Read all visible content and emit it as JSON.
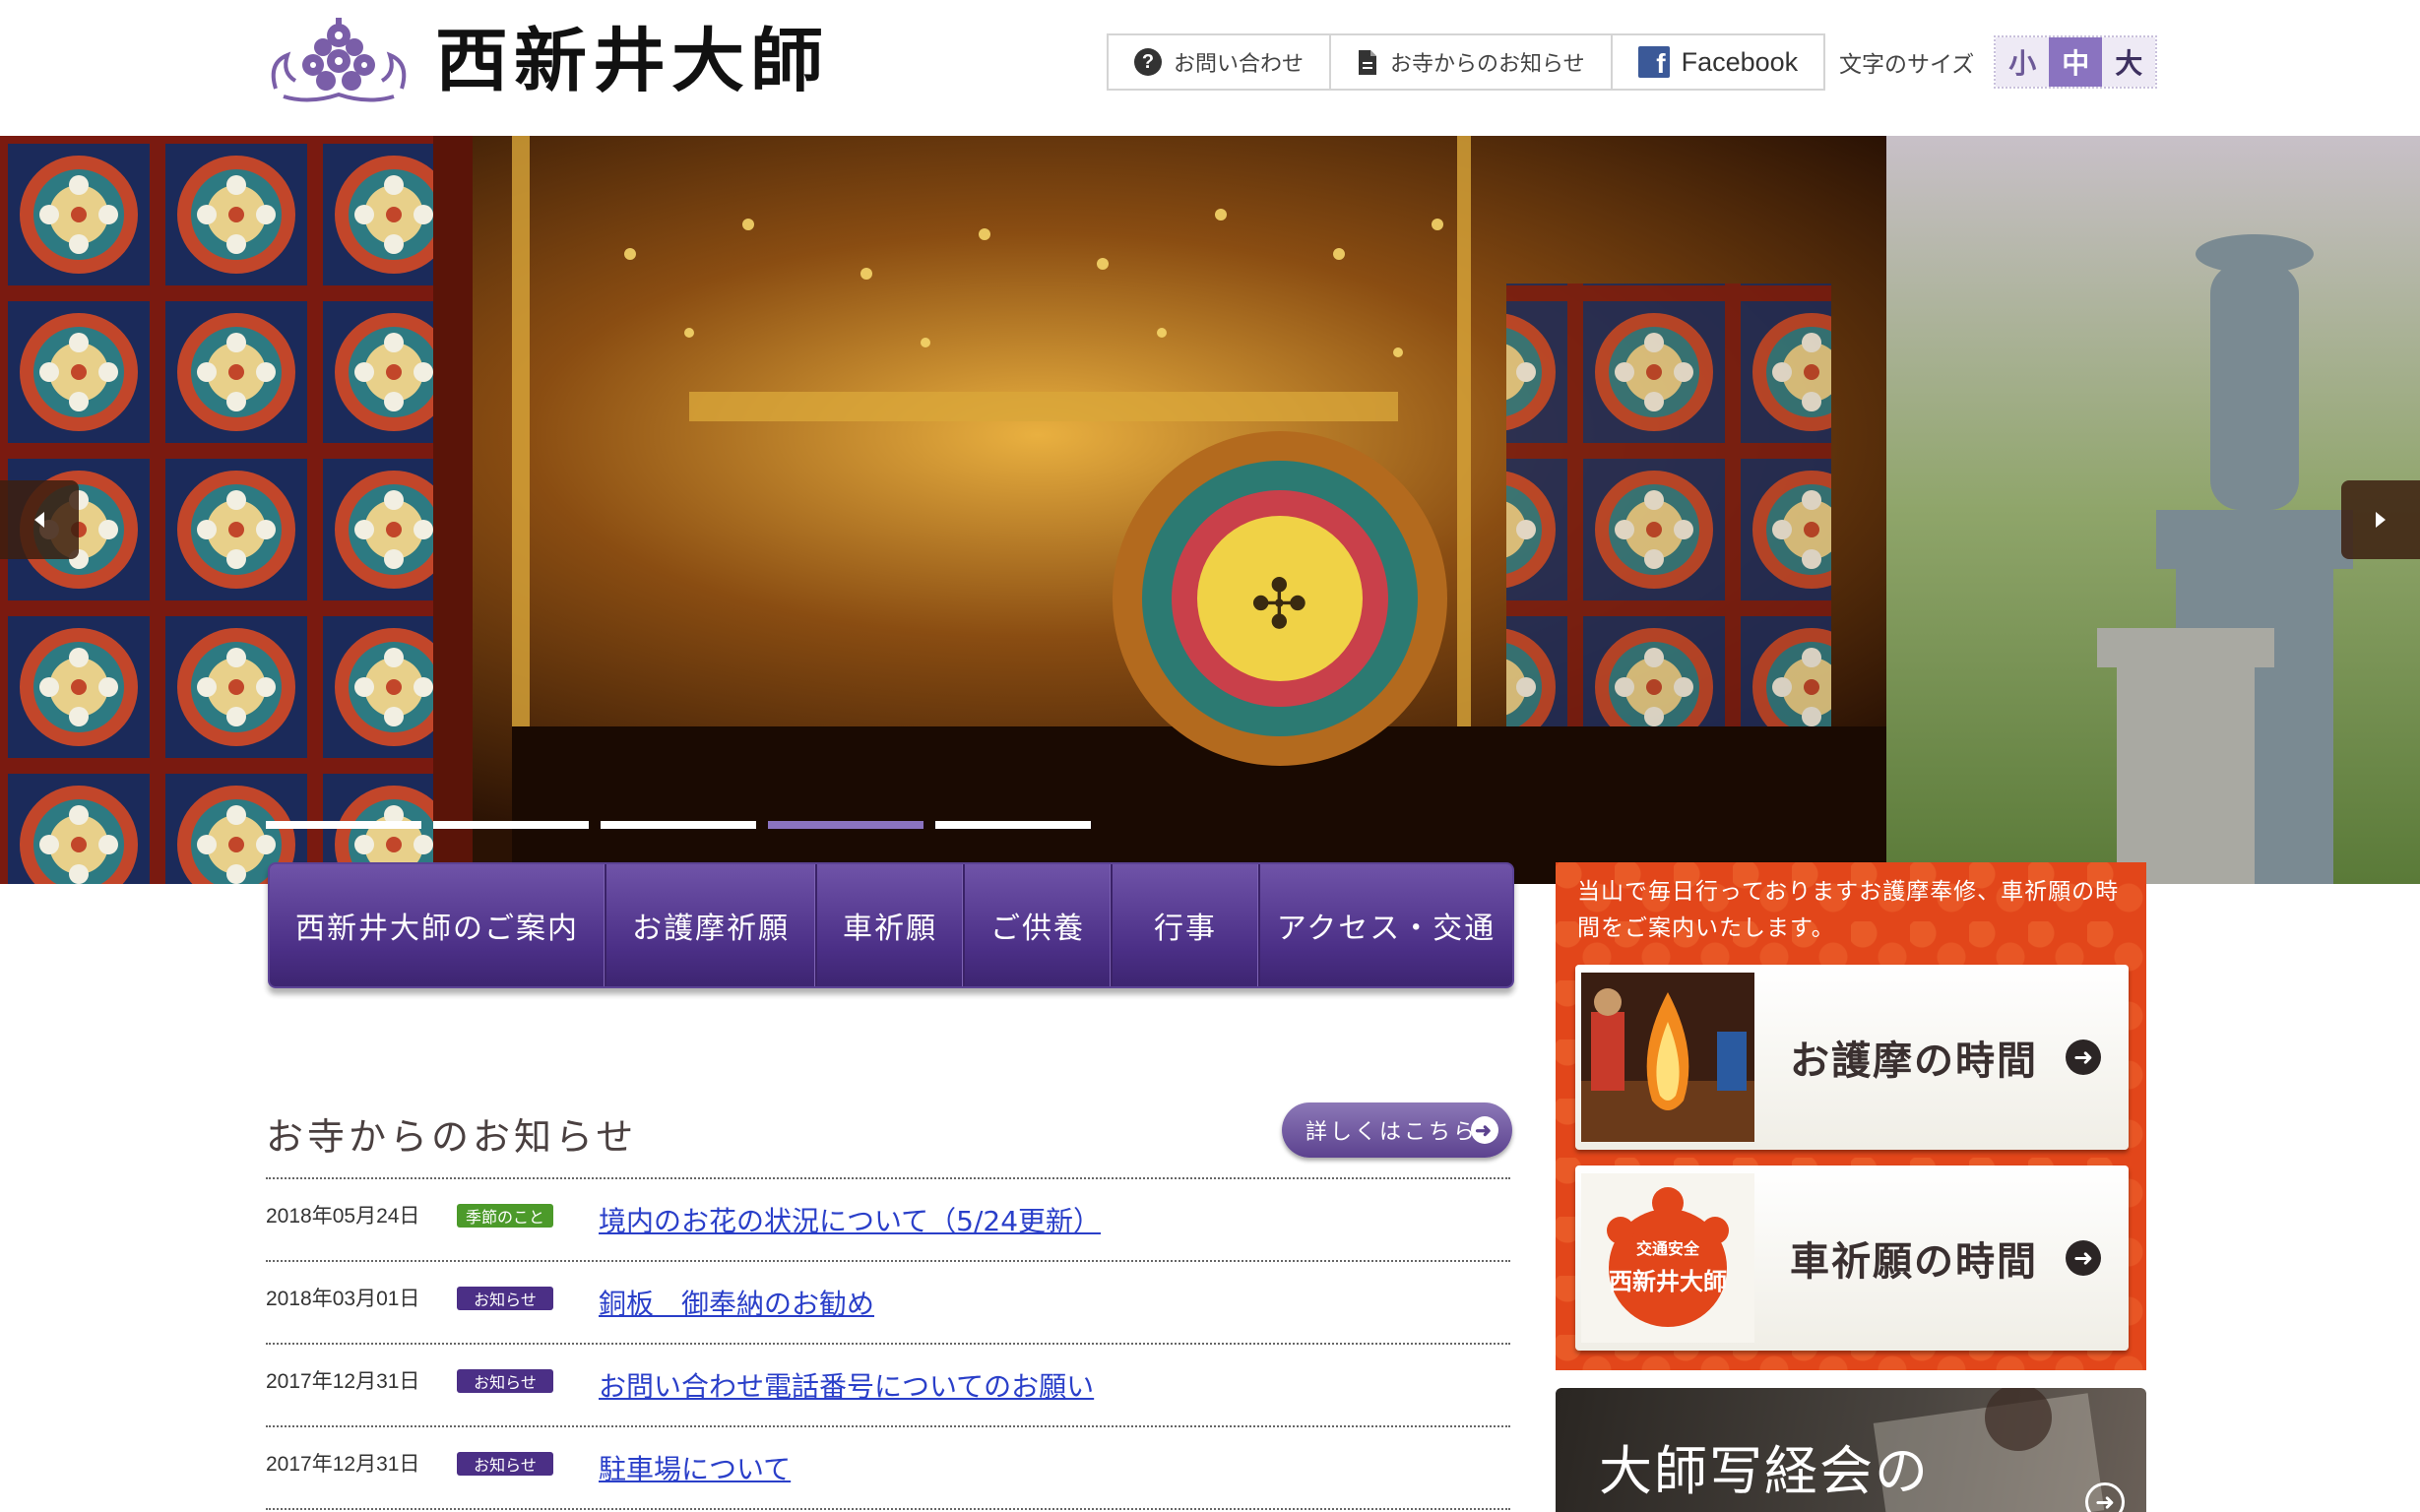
{
  "site": {
    "logo_text": "西新井大師",
    "brand_color": "#4b2f86",
    "accent_color": "#8a73c0",
    "sidebar_color": "#e2461a"
  },
  "header": {
    "links": [
      {
        "label": "お問い合わせ",
        "icon": "question-circle-icon"
      },
      {
        "label": "お寺からのお知らせ",
        "icon": "document-icon"
      },
      {
        "label": "Facebook",
        "icon": "facebook-icon"
      }
    ],
    "font_size": {
      "label": "文字のサイズ",
      "options": [
        "小",
        "中",
        "大"
      ],
      "selected": "中"
    }
  },
  "slider": {
    "slide_count": 5,
    "active_index": 3
  },
  "main_nav": [
    "西新井大師のご案内",
    "お護摩祈願",
    "車祈願",
    "ご供養",
    "行事",
    "アクセス・交通"
  ],
  "news": {
    "heading": "お寺からのお知らせ",
    "more_label": "詳しくはこちら",
    "items": [
      {
        "date": "2018年05月24日",
        "badge": "季節のこと",
        "title": "境内のお花の状況について（5/24更新）"
      },
      {
        "date": "2018年03月01日",
        "badge": "お知らせ",
        "title": "銅板　御奉納のお勧め"
      },
      {
        "date": "2017年12月31日",
        "badge": "お知らせ",
        "title": "お問い合わせ電話番号についてのお願い"
      },
      {
        "date": "2017年12月31日",
        "badge": "お知らせ",
        "title": "駐車場について"
      }
    ]
  },
  "sidebar": {
    "intro": "当山で毎日行っておりますお護摩奉修、車祈願の時間をご案内いたします。",
    "cards": [
      {
        "label": "お護摩の時間"
      },
      {
        "label": "車祈願の時間"
      }
    ],
    "sutra_label": "大師写経会の",
    "seal_text": [
      "交通安全",
      "西新井大師"
    ]
  }
}
